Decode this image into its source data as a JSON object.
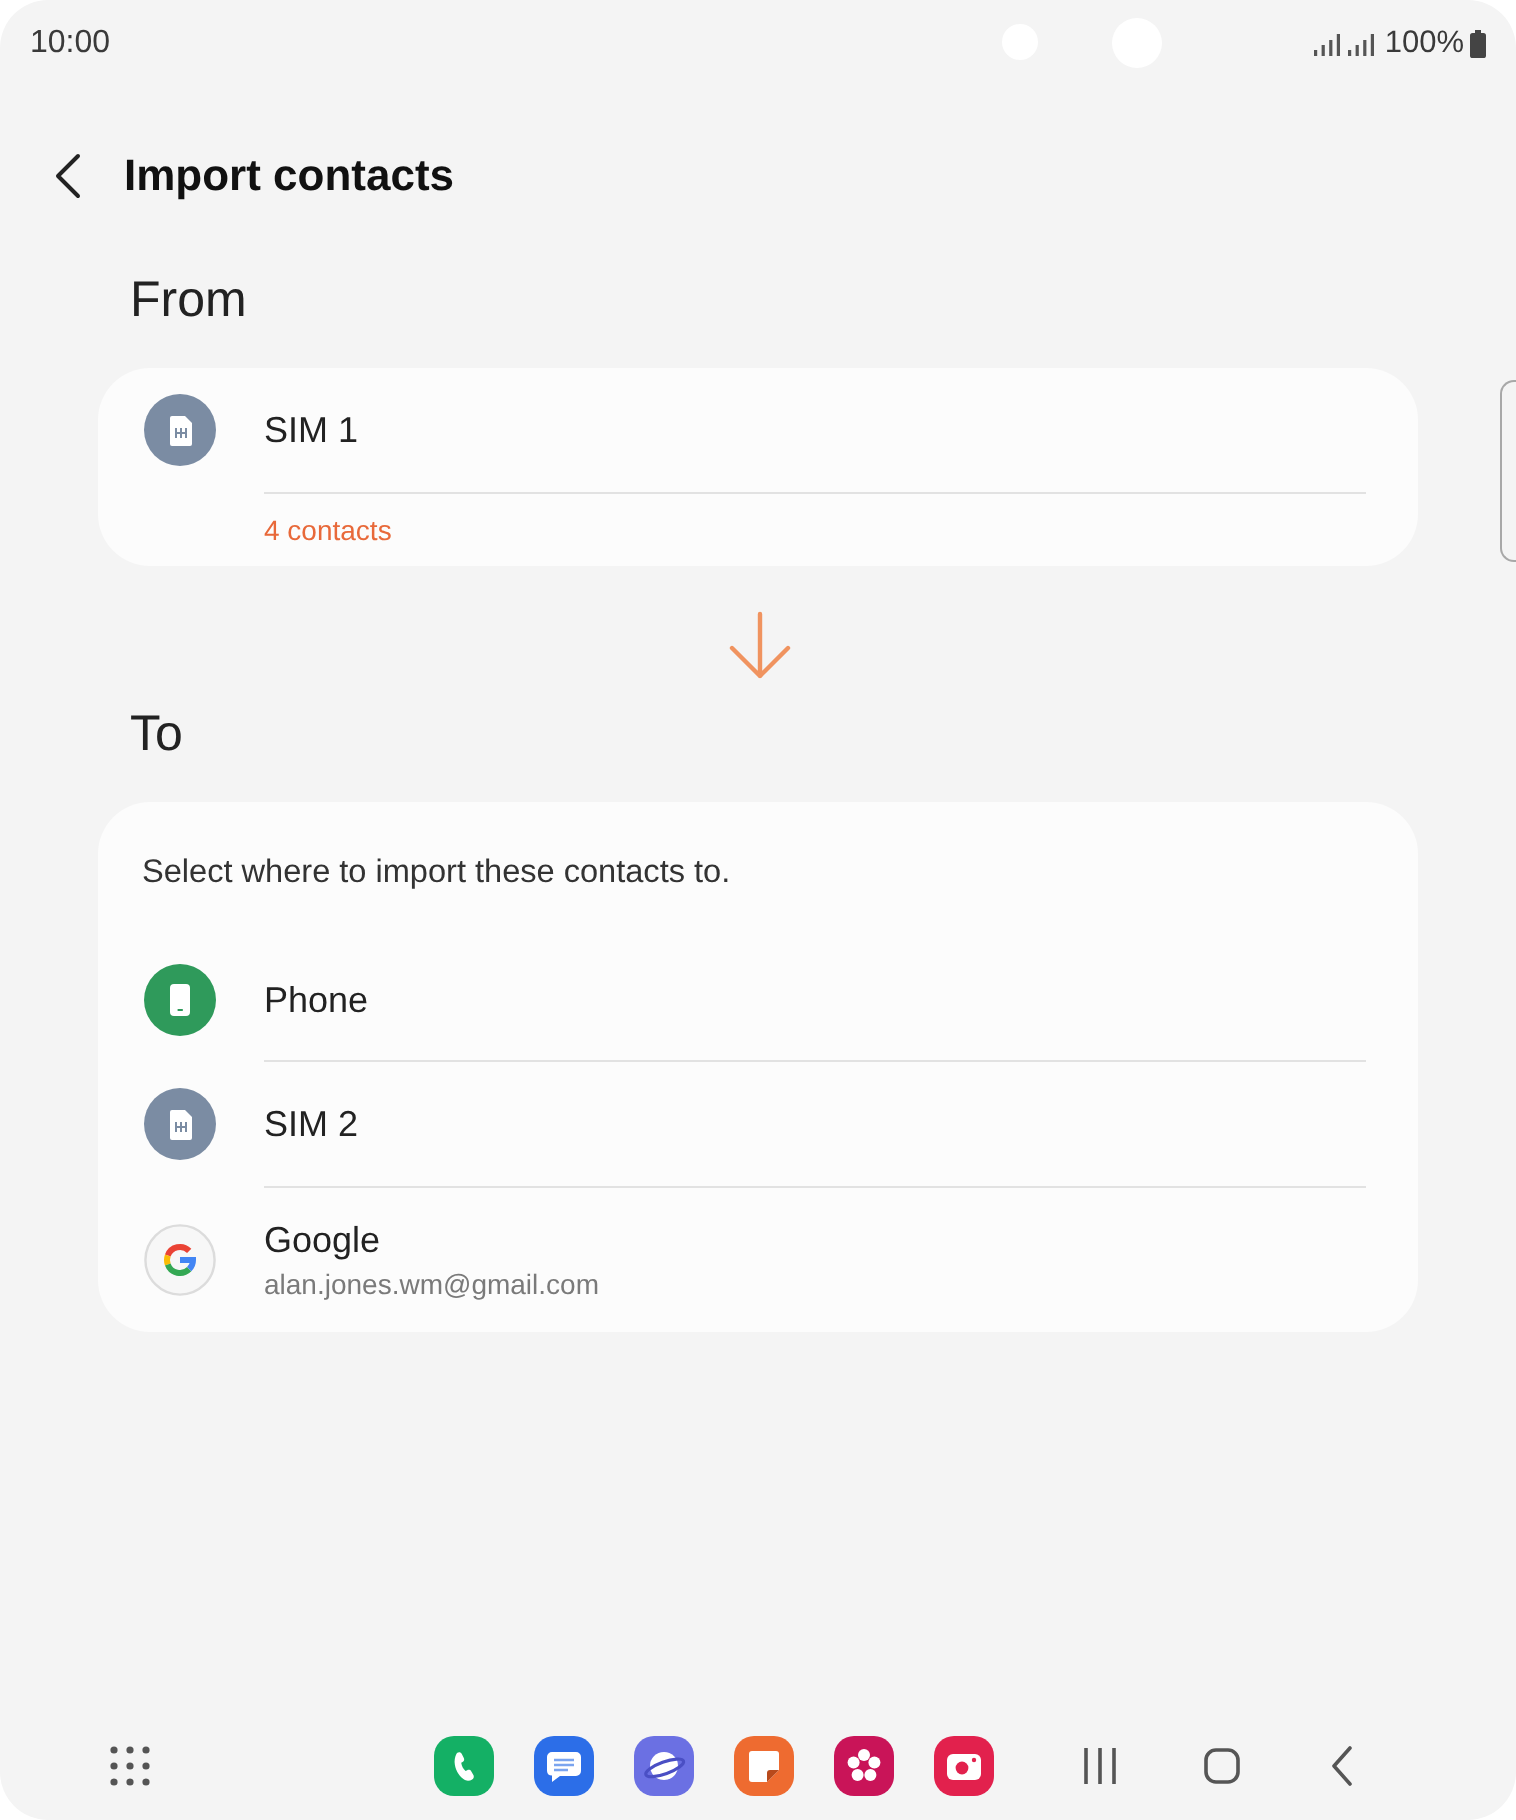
{
  "status_bar": {
    "time": "10:00",
    "battery": "100%"
  },
  "header": {
    "title": "Import contacts"
  },
  "from": {
    "heading": "From",
    "source": {
      "kind": "sim",
      "name": "SIM 1",
      "detail": "4 contacts"
    }
  },
  "to": {
    "heading": "To",
    "instruction": "Select where to import these contacts to.",
    "targets": [
      {
        "kind": "phone",
        "name": "Phone"
      },
      {
        "kind": "sim",
        "name": "SIM 2"
      },
      {
        "kind": "google",
        "name": "Google",
        "detail": "alan.jones.wm@gmail.com"
      }
    ]
  },
  "nav_bar": {
    "apps": [
      {
        "kind": "phone",
        "color": "#14b065"
      },
      {
        "kind": "messages",
        "color": "#2c6ee8"
      },
      {
        "kind": "internet",
        "color": "#6b70e3"
      },
      {
        "kind": "notes",
        "color": "#ee6b30"
      },
      {
        "kind": "gallery",
        "color": "#c91458"
      },
      {
        "kind": "camera",
        "color": "#e2214d"
      }
    ]
  }
}
